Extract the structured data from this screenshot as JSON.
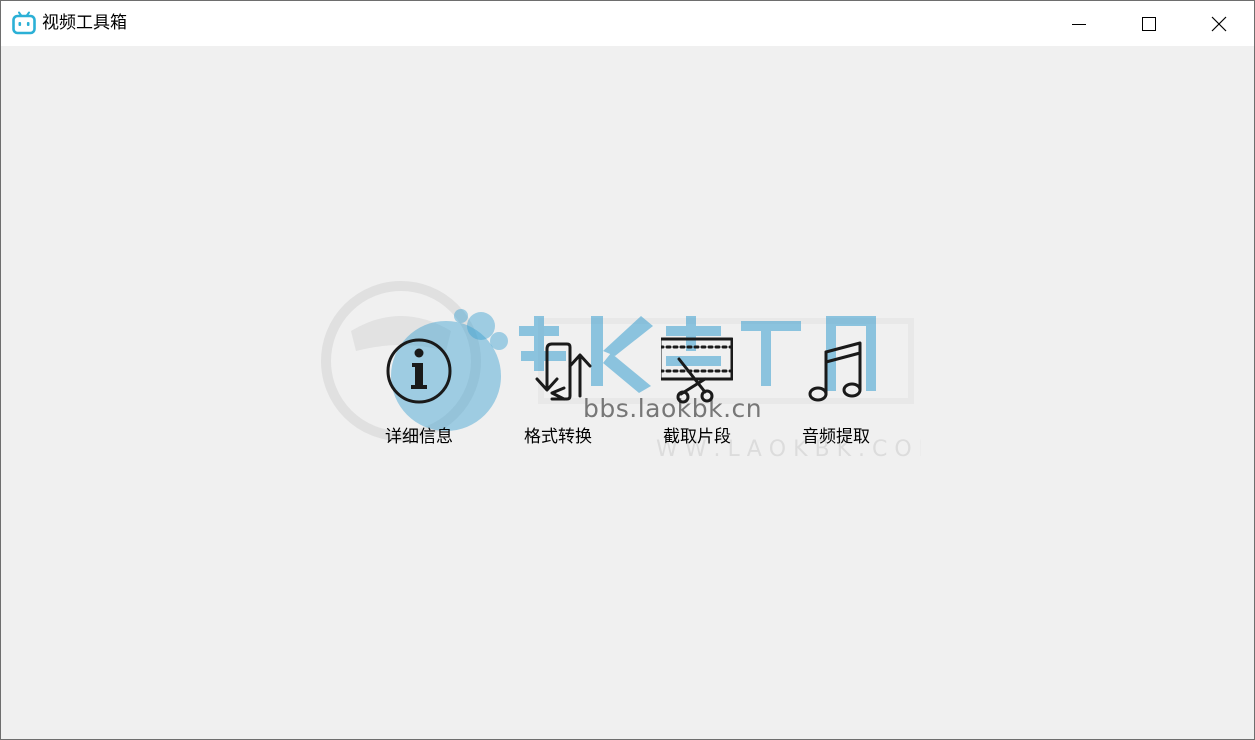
{
  "window": {
    "title": "视频工具箱",
    "app_icon": "bilibili-tv-icon",
    "accent": "#2bb0d6",
    "controls": {
      "minimize": "minimize-icon",
      "maximize": "maximize-icon",
      "close": "close-icon"
    }
  },
  "tools": [
    {
      "label": "详细信息",
      "icon": "info-icon"
    },
    {
      "label": "格式转换",
      "icon": "convert-arrows-icon"
    },
    {
      "label": "截取片段",
      "icon": "film-cut-icon"
    },
    {
      "label": "音频提取",
      "icon": "music-note-icon"
    }
  ],
  "watermark": {
    "text": "bbs.laokbk.cn",
    "logo_text": "老K资源网",
    "color": "#3a9fd0"
  }
}
